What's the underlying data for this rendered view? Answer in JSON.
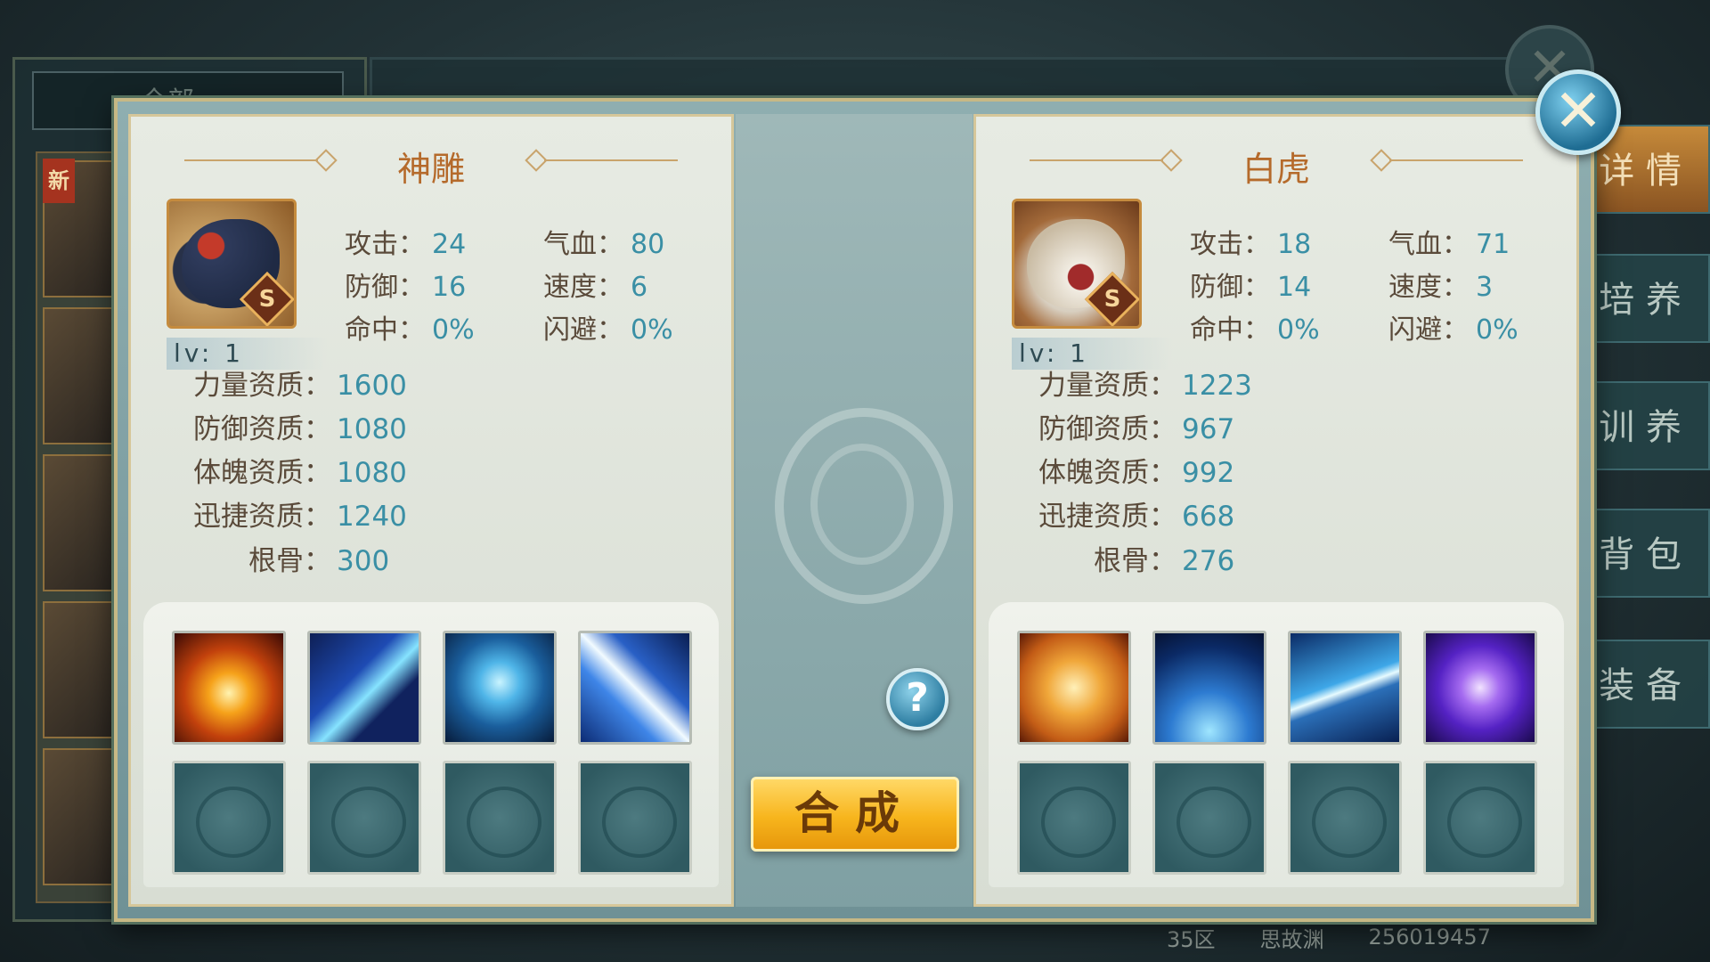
{
  "background": {
    "tab_all": "全部",
    "new_badge": "新",
    "side_tabs": [
      "详 情",
      "培 养",
      "训 养",
      "背 包",
      "装 备"
    ],
    "footer": {
      "server": "35区",
      "name": "思故渊",
      "id": "256019457"
    }
  },
  "left_pet": {
    "name": "神雕",
    "grade": "S",
    "level": "lv: 1",
    "stats": [
      {
        "label": "攻击：",
        "value": "24"
      },
      {
        "label": "气血：",
        "value": "80"
      },
      {
        "label": "防御：",
        "value": "16"
      },
      {
        "label": "速度：",
        "value": "6"
      },
      {
        "label": "命中：",
        "value": "0%"
      },
      {
        "label": "闪避：",
        "value": "0%"
      }
    ],
    "aptitudes": [
      {
        "label": "力量资质：",
        "value": "1600"
      },
      {
        "label": "防御资质：",
        "value": "1080"
      },
      {
        "label": "体魄资质：",
        "value": "1080"
      },
      {
        "label": "迅捷资质：",
        "value": "1240"
      },
      {
        "label": "根骨：",
        "value": "300"
      }
    ],
    "skills": [
      "fire-phoenix-icon",
      "claw-slash-icon",
      "blue-heart-icon",
      "lightning-strike-icon"
    ]
  },
  "right_pet": {
    "name": "白虎",
    "grade": "S",
    "level": "lv: 1",
    "stats": [
      {
        "label": "攻击：",
        "value": "18"
      },
      {
        "label": "气血：",
        "value": "71"
      },
      {
        "label": "防御：",
        "value": "14"
      },
      {
        "label": "速度：",
        "value": "3"
      },
      {
        "label": "命中：",
        "value": "0%"
      },
      {
        "label": "闪避：",
        "value": "0%"
      }
    ],
    "aptitudes": [
      {
        "label": "力量资质：",
        "value": "1223"
      },
      {
        "label": "防御资质：",
        "value": "967"
      },
      {
        "label": "体魄资质：",
        "value": "992"
      },
      {
        "label": "迅捷资质：",
        "value": "668"
      },
      {
        "label": "根骨：",
        "value": "276"
      }
    ],
    "skills": [
      "golden-tiger-icon",
      "ice-spikes-icon",
      "thunder-icon",
      "purple-vortex-icon"
    ]
  },
  "merge_button": "合成",
  "help_button": "?",
  "close_button": "✕"
}
